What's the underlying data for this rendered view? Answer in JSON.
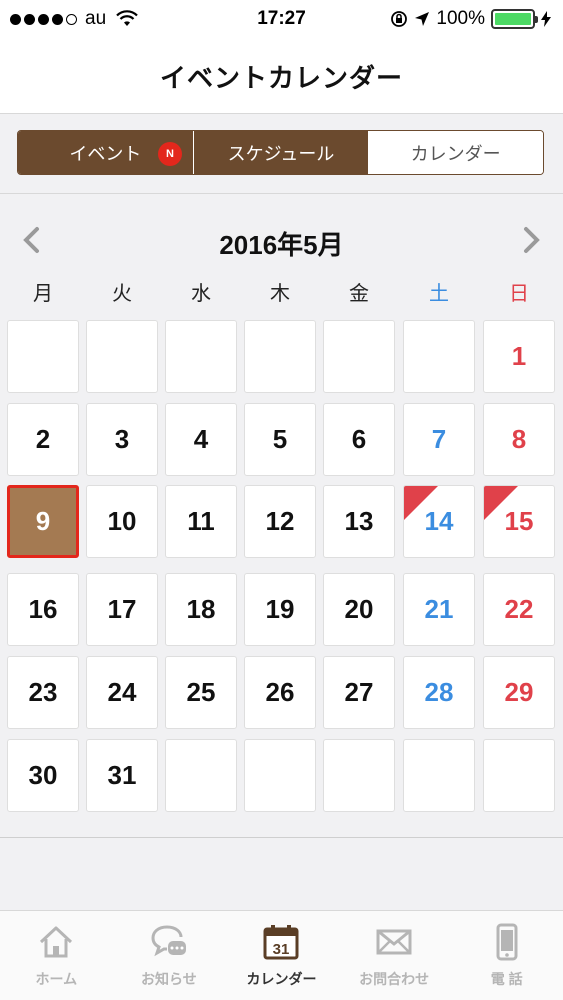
{
  "status": {
    "carrier": "au",
    "time": "17:27",
    "battery": "100%",
    "battery_level": 1.0,
    "battery_color": "#4cd964"
  },
  "nav": {
    "title": "イベントカレンダー"
  },
  "segments": [
    {
      "label": "イベント",
      "badge": "N",
      "style": "dark"
    },
    {
      "label": "スケジュール",
      "style": "dark"
    },
    {
      "label": "カレンダー",
      "style": "light"
    }
  ],
  "calendar": {
    "month_title": "2016年5月",
    "weekdays": [
      "月",
      "火",
      "水",
      "木",
      "金",
      "土",
      "日"
    ],
    "days": [
      {
        "day": "",
        "type": "empty"
      },
      {
        "day": "",
        "type": "empty"
      },
      {
        "day": "",
        "type": "empty"
      },
      {
        "day": "",
        "type": "empty"
      },
      {
        "day": "",
        "type": "empty"
      },
      {
        "day": "",
        "type": "empty"
      },
      {
        "day": "1",
        "type": "sun"
      },
      {
        "day": "2",
        "type": "weekday"
      },
      {
        "day": "3",
        "type": "weekday"
      },
      {
        "day": "4",
        "type": "weekday"
      },
      {
        "day": "5",
        "type": "weekday"
      },
      {
        "day": "6",
        "type": "weekday"
      },
      {
        "day": "7",
        "type": "sat"
      },
      {
        "day": "8",
        "type": "sun"
      },
      {
        "day": "9",
        "type": "weekday",
        "today": true
      },
      {
        "day": "10",
        "type": "weekday"
      },
      {
        "day": "11",
        "type": "weekday"
      },
      {
        "day": "12",
        "type": "weekday"
      },
      {
        "day": "13",
        "type": "weekday"
      },
      {
        "day": "14",
        "type": "sat",
        "event": true
      },
      {
        "day": "15",
        "type": "sun",
        "event": true
      },
      {
        "day": "16",
        "type": "weekday"
      },
      {
        "day": "17",
        "type": "weekday"
      },
      {
        "day": "18",
        "type": "weekday"
      },
      {
        "day": "19",
        "type": "weekday"
      },
      {
        "day": "20",
        "type": "weekday"
      },
      {
        "day": "21",
        "type": "sat"
      },
      {
        "day": "22",
        "type": "sun"
      },
      {
        "day": "23",
        "type": "weekday"
      },
      {
        "day": "24",
        "type": "weekday"
      },
      {
        "day": "25",
        "type": "weekday"
      },
      {
        "day": "26",
        "type": "weekday"
      },
      {
        "day": "27",
        "type": "weekday"
      },
      {
        "day": "28",
        "type": "sat"
      },
      {
        "day": "29",
        "type": "sun"
      },
      {
        "day": "30",
        "type": "weekday"
      },
      {
        "day": "31",
        "type": "weekday"
      },
      {
        "day": "",
        "type": "empty"
      },
      {
        "day": "",
        "type": "empty"
      },
      {
        "day": "",
        "type": "empty"
      },
      {
        "day": "",
        "type": "empty"
      },
      {
        "day": "",
        "type": "empty"
      }
    ]
  },
  "tabs": [
    {
      "label": "ホーム",
      "icon": "home-icon"
    },
    {
      "label": "お知らせ",
      "icon": "chat-icon"
    },
    {
      "label": "カレンダー",
      "icon": "calendar-icon",
      "active": true,
      "icon_text": "31"
    },
    {
      "label": "お問合わせ",
      "icon": "mail-icon"
    },
    {
      "label": "電 話",
      "icon": "phone-icon"
    }
  ],
  "colors": {
    "accent_brown": "#6b4a2e",
    "today_fill": "#a47a52",
    "today_border": "#e3271c",
    "saturday": "#3b8de0",
    "sunday": "#e0414a"
  }
}
